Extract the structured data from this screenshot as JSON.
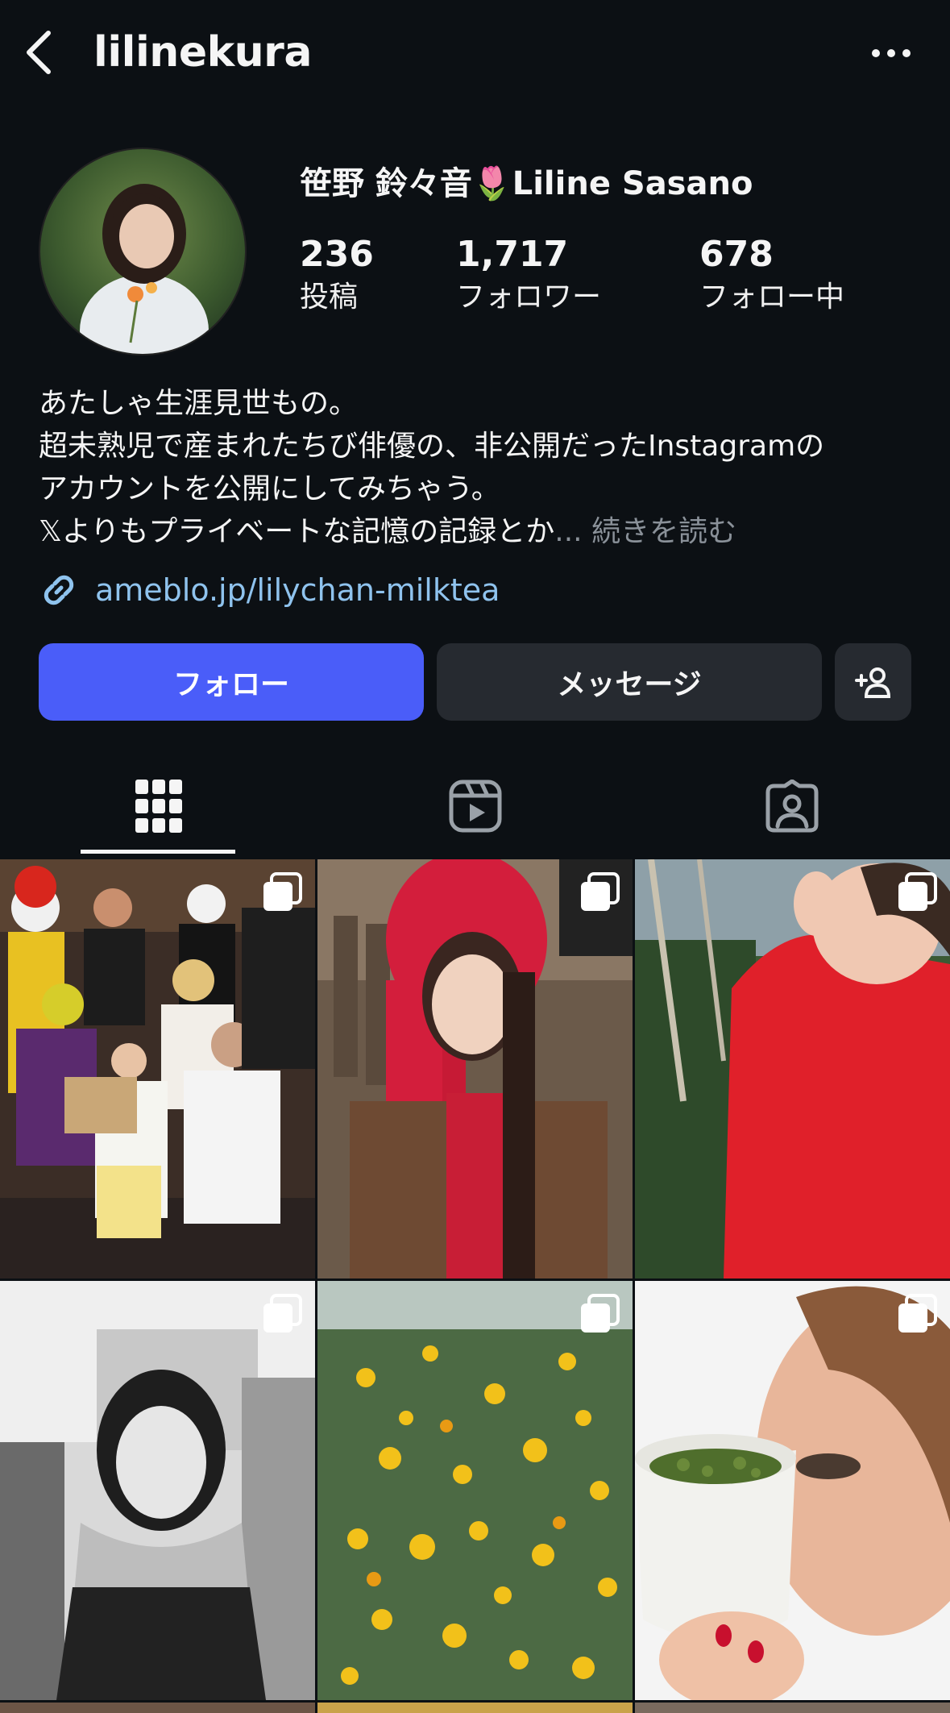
{
  "header": {
    "username": "lilinekura",
    "back_icon": "chevron-left-icon",
    "more_icon": "more-horizontal-icon"
  },
  "profile": {
    "full_name": "笹野 鈴々音🌷Liline Sasano",
    "stats": [
      {
        "number": "236",
        "label": "投稿"
      },
      {
        "number": "1,717",
        "label": "フォロワー"
      },
      {
        "number": "678",
        "label": "フォロー中"
      }
    ],
    "bio_lines": [
      "あたしゃ生涯見世もの。",
      "超未熟児で産まれたちび俳優の、非公開だったInstagramの",
      "アカウントを公開にしてみちゃう。",
      "𝕏よりもプライベートな記憶の記録とか"
    ],
    "bio_more": "... 続きを読む",
    "link": "ameblo.jp/lilychan-milktea"
  },
  "actions": {
    "follow_label": "フォロー",
    "message_label": "メッセージ",
    "suggest_icon": "add-person-icon"
  },
  "tabs": [
    {
      "icon": "grid-icon",
      "active": true
    },
    {
      "icon": "reels-icon",
      "active": false
    },
    {
      "icon": "tagged-icon",
      "active": false
    }
  ],
  "colors": {
    "background": "#0c1014",
    "follow_button": "#4a5df9",
    "secondary_button": "#262a30",
    "link": "#8fc3ee",
    "muted": "#8a9199"
  },
  "posts": [
    {
      "type": "carousel"
    },
    {
      "type": "carousel"
    },
    {
      "type": "carousel"
    },
    {
      "type": "carousel"
    },
    {
      "type": "carousel"
    },
    {
      "type": "carousel"
    }
  ]
}
